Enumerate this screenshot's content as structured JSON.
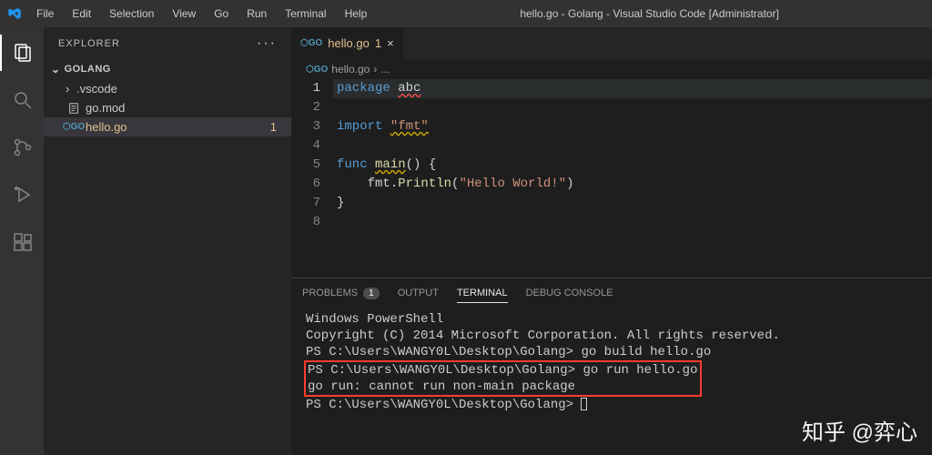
{
  "titlebar": {
    "menu": [
      "File",
      "Edit",
      "Selection",
      "View",
      "Go",
      "Run",
      "Terminal",
      "Help"
    ],
    "title": "hello.go - Golang - Visual Studio Code [Administrator]"
  },
  "sidebar": {
    "header": "EXPLORER",
    "folder": "GOLANG",
    "items": [
      {
        "name": ".vscode",
        "type": "folder"
      },
      {
        "name": "go.mod",
        "type": "file"
      },
      {
        "name": "hello.go",
        "type": "go",
        "modified": true,
        "badge": "1",
        "selected": true
      }
    ]
  },
  "tabs": [
    {
      "icon": "go",
      "name": "hello.go",
      "badge": "1"
    }
  ],
  "breadcrumb": {
    "icon": "go",
    "file": "hello.go",
    "sep": "›",
    "rest": "..."
  },
  "code": {
    "lines": [
      {
        "n": 1,
        "active": true,
        "tokens": [
          [
            "kw",
            "package"
          ],
          [
            "sp",
            " "
          ],
          [
            "id und-err",
            "abc"
          ]
        ]
      },
      {
        "n": 2,
        "tokens": []
      },
      {
        "n": 3,
        "tokens": [
          [
            "kw",
            "import"
          ],
          [
            "sp",
            " "
          ],
          [
            "str und",
            "\"fmt\""
          ]
        ]
      },
      {
        "n": 4,
        "tokens": []
      },
      {
        "n": 5,
        "tokens": [
          [
            "kw",
            "func"
          ],
          [
            "sp",
            " "
          ],
          [
            "fn und",
            "main"
          ],
          [
            "id",
            "() {"
          ]
        ]
      },
      {
        "n": 6,
        "tokens": [
          [
            "sp",
            "    "
          ],
          [
            "id",
            "fmt."
          ],
          [
            "fn",
            "Println"
          ],
          [
            "id",
            "("
          ],
          [
            "str",
            "\"Hello World!\""
          ],
          [
            "id",
            ")"
          ]
        ]
      },
      {
        "n": 7,
        "tokens": [
          [
            "id",
            "}"
          ]
        ]
      },
      {
        "n": 8,
        "tokens": []
      }
    ]
  },
  "panel": {
    "tabs": {
      "problems": "PROBLEMS",
      "problems_count": "1",
      "output": "OUTPUT",
      "terminal": "TERMINAL",
      "debug": "DEBUG CONSOLE"
    },
    "terminal": {
      "line1": "Windows PowerShell",
      "line2": "Copyright (C) 2014 Microsoft Corporation. All rights reserved.",
      "blank": "",
      "prompt": "PS C:\\Users\\WANGY0L\\Desktop\\Golang>",
      "cmd1": "go build hello.go",
      "cmd2": "go run hello.go",
      "err": "go run: cannot run non-main package"
    }
  },
  "watermark": "知乎 @弈心"
}
